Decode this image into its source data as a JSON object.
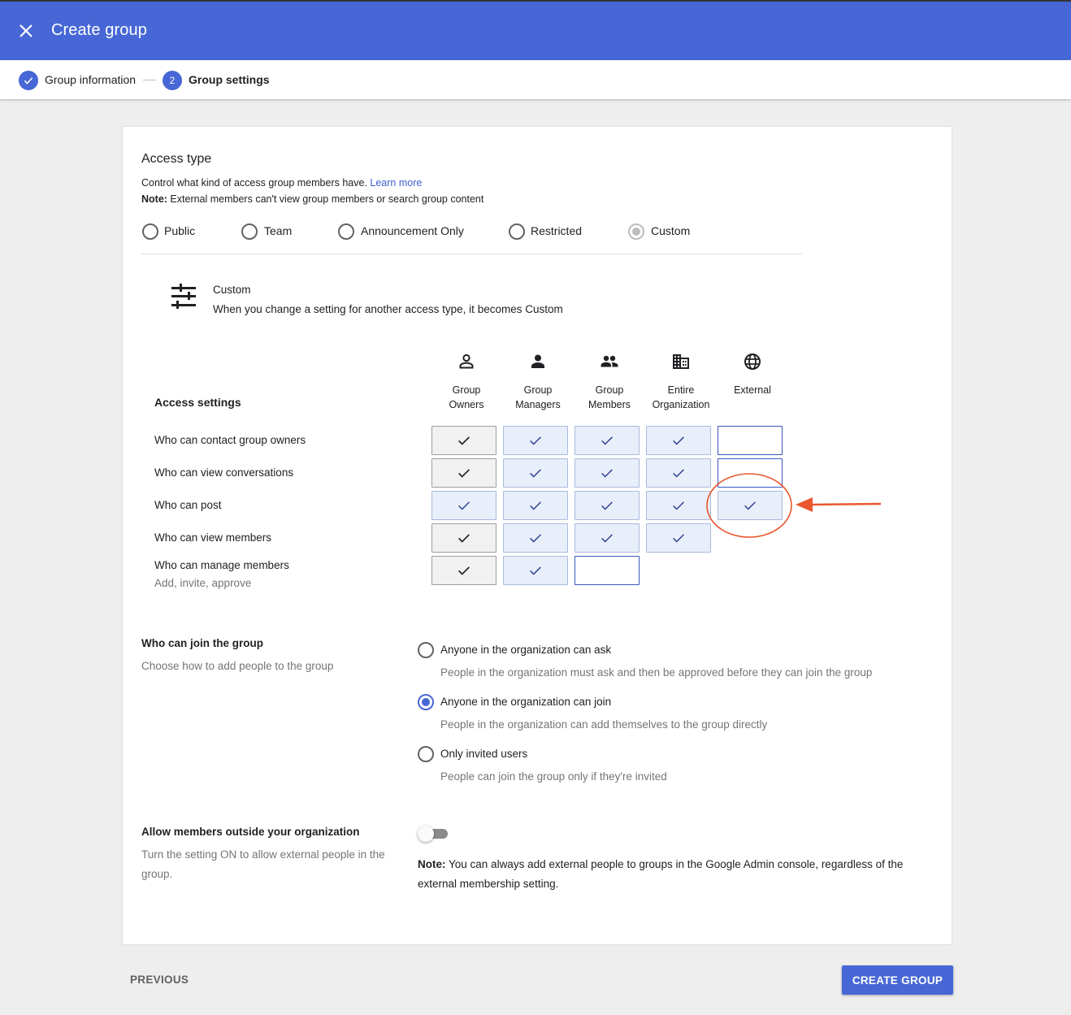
{
  "app": {
    "title": "Create group",
    "accent_color": "#4767d6",
    "close_icon": "close-icon"
  },
  "stepper": {
    "steps": [
      {
        "label": "Group information",
        "state": "complete",
        "marker": "✓"
      },
      {
        "label": "Group settings",
        "state": "active",
        "marker": "2"
      }
    ]
  },
  "access_type": {
    "heading": "Access type",
    "description": "Control what kind of access group members have.",
    "learn_more": "Learn more",
    "note_label": "Note:",
    "note_text": " External members can't view group members or search group content",
    "options": [
      {
        "label": "Public",
        "selected": false
      },
      {
        "label": "Team",
        "selected": false
      },
      {
        "label": "Announcement Only",
        "selected": false
      },
      {
        "label": "Restricted",
        "selected": false
      },
      {
        "label": "Custom",
        "selected": true
      }
    ],
    "custom_title": "Custom",
    "custom_description": "When you change a setting for another access type, it becomes Custom",
    "custom_icon": "tune-icon"
  },
  "access_settings": {
    "heading": "Access settings",
    "columns": [
      {
        "line1": "Group",
        "line2": "Owners",
        "icon": "person-outline-icon"
      },
      {
        "line1": "Group",
        "line2": "Managers",
        "icon": "person-icon"
      },
      {
        "line1": "Group",
        "line2": "Members",
        "icon": "people-icon"
      },
      {
        "line1": "Entire",
        "line2": "Organization",
        "icon": "domain-icon"
      },
      {
        "line1": "External",
        "line2": "",
        "icon": "globe-icon"
      }
    ],
    "rows": [
      {
        "label": "Who can contact group owners",
        "sublabel": "",
        "cells": [
          "owner",
          "on",
          "on",
          "on",
          "empty"
        ]
      },
      {
        "label": "Who can view conversations",
        "sublabel": "",
        "cells": [
          "owner",
          "on",
          "on",
          "on",
          "empty"
        ]
      },
      {
        "label": "Who can post",
        "sublabel": "",
        "cells": [
          "on",
          "on",
          "on",
          "on",
          "on"
        ]
      },
      {
        "label": "Who can view members",
        "sublabel": "",
        "cells": [
          "owner",
          "on",
          "on",
          "on",
          "none"
        ]
      },
      {
        "label": "Who can manage members",
        "sublabel": "Add, invite, approve",
        "cells": [
          "owner",
          "on",
          "empty",
          "none",
          "none"
        ]
      }
    ]
  },
  "join": {
    "title": "Who can join the group",
    "description": "Choose how to add people to the group",
    "options": [
      {
        "label": "Anyone in the organization can ask",
        "description": "People in the organization must ask and then be approved before they can join the group",
        "selected": false
      },
      {
        "label": "Anyone in the organization can join",
        "description": "People in the organization can add themselves to the group directly",
        "selected": true
      },
      {
        "label": "Only invited users",
        "description": "People can join the group only if they're invited",
        "selected": false
      }
    ]
  },
  "external": {
    "title": "Allow members outside your organization",
    "description": "Turn the setting ON to allow external people in the group.",
    "toggle_on": false,
    "note_label": "Note:",
    "note_text": " You can always add external people to groups in the Google Admin console, regardless of the external membership setting."
  },
  "footer": {
    "previous": "PREVIOUS",
    "create": "CREATE GROUP"
  },
  "annotation": {
    "color": "#e8572e"
  }
}
